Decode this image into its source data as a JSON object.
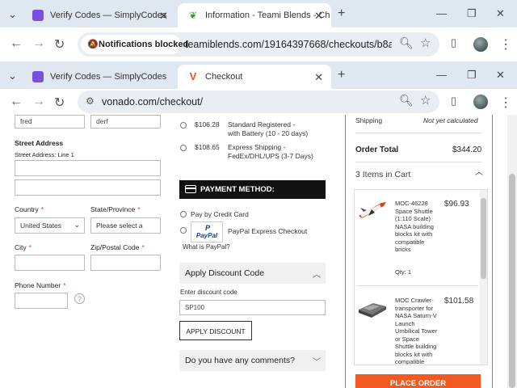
{
  "window1": {
    "tabs": [
      {
        "label": "Verify Codes — SimplyCodes",
        "icon": "simplycodes-icon"
      },
      {
        "label": "Information - Teami Blends - Ch",
        "icon": "teami-leaf-icon"
      }
    ],
    "notification_chip": "Notifications blocked",
    "url": "teamiblends.com/19164397668/checkouts/b8a949..."
  },
  "window2": {
    "tabs": [
      {
        "label": "Verify Codes — SimplyCodes",
        "icon": "simplycodes-icon"
      },
      {
        "label": "Checkout",
        "icon": "vonado-icon"
      }
    ],
    "url": "vonado.com/checkout/"
  },
  "form": {
    "first_name_value": "fred",
    "last_name_value": "derf",
    "street_address_label": "Street Address",
    "street_address_line1_label": "Street Address: Line 1",
    "country_label": "Country",
    "country_value": "United States",
    "state_label": "State/Province",
    "state_value": "Please select a",
    "city_label": "City",
    "zip_label": "Zip/Postal Code",
    "phone_label": "Phone Number",
    "required_mark": "*"
  },
  "shipping_options": [
    {
      "price": "$106.28",
      "line1": "Standard Registered -",
      "line2": "with Battery (10 - 20 days)"
    },
    {
      "price": "$108.65",
      "line1": "Express Shipping -",
      "line2": "FedEx/DHL/UPS (3-7 Days)"
    }
  ],
  "payment": {
    "header": "PAYMENT METHOD:",
    "credit_card_label": "Pay by Credit Card",
    "paypal_label": "PayPal Express Checkout",
    "paypal_logo": "PayPal",
    "what_is_paypal": "What is PayPal?"
  },
  "discount": {
    "accordion_title": "Apply Discount Code",
    "input_label": "Enter discount code",
    "input_value": "SP100",
    "button_label": "APPLY DISCOUNT"
  },
  "comments": {
    "accordion_title": "Do you have any comments?"
  },
  "summary": {
    "shipping_label": "Shipping",
    "shipping_value": "Not yet calculated",
    "order_total_label": "Order Total",
    "order_total_value": "$344.20",
    "cart_header": "3 Items in Cart",
    "items": [
      {
        "name_lines": [
          "MOC-46228",
          "Space Shuttle",
          "(1:110 Scale)",
          "NASA building",
          "blocks kit with",
          "compatible",
          "bricks"
        ],
        "price": "$96.93",
        "qty": "Qty: 1"
      },
      {
        "name_lines": [
          "MOC Crawler-",
          "transporter for",
          "NASA Saturn-V",
          "Launch",
          "Umbilical Tower",
          "or Space",
          "Shuttle building",
          "blocks kit with",
          "compatible"
        ],
        "price": "$101.58"
      }
    ],
    "place_order_label": "PLACE ORDER"
  }
}
